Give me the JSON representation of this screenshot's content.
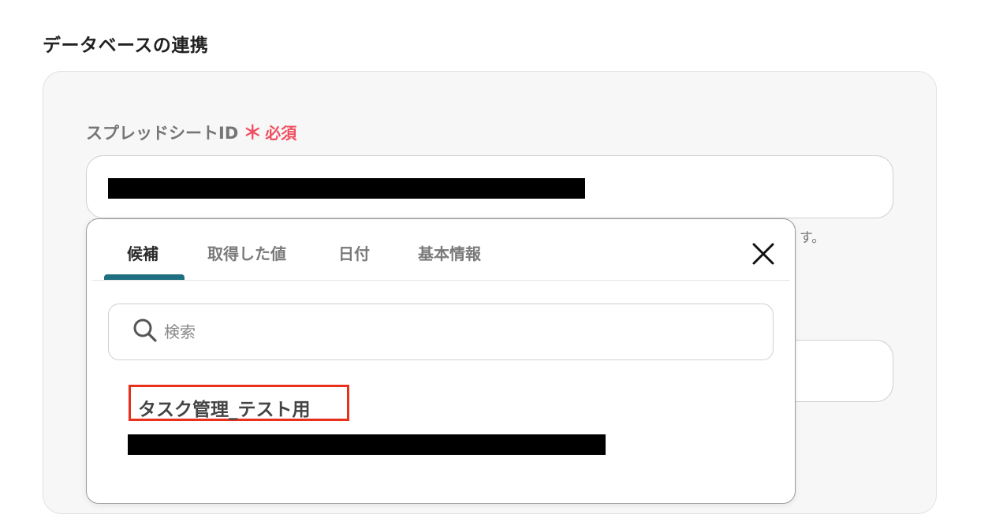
{
  "section": {
    "title": "データベースの連携"
  },
  "field": {
    "label": "スプレッドシートID",
    "required_mark": "＊",
    "required_text": "必須",
    "help_tail": "す。"
  },
  "popup": {
    "tabs": [
      {
        "label": "候補",
        "active": true
      },
      {
        "label": "取得した値",
        "active": false
      },
      {
        "label": "日付",
        "active": false
      },
      {
        "label": "基本情報",
        "active": false
      }
    ],
    "search": {
      "placeholder": "検索",
      "value": ""
    },
    "candidates": [
      {
        "name": "タスク管理_テスト用",
        "highlighted": true
      }
    ]
  },
  "colors": {
    "required": "#ef4f62",
    "tab_active_underline": "#1f6f80",
    "highlight_box": "#e8301c"
  },
  "icons": {
    "close": "close-icon",
    "search": "search-icon"
  }
}
